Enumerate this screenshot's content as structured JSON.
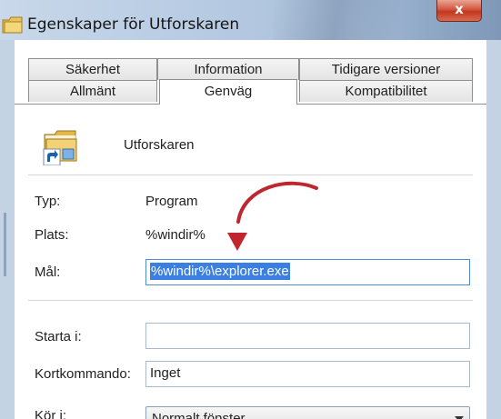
{
  "window": {
    "title": "Egenskaper för Utforskaren",
    "close_label": "x"
  },
  "tabs": {
    "row1": [
      "Säkerhet",
      "Information",
      "Tidigare versioner"
    ],
    "row2": [
      "Allmänt",
      "Genväg",
      "Kompatibilitet"
    ],
    "active": "Genväg"
  },
  "program": {
    "name": "Utforskaren",
    "icon": "folder-shortcut-icon"
  },
  "fields": {
    "type_label": "Typ:",
    "type_value": "Program",
    "location_label": "Plats:",
    "location_value": "%windir%",
    "target_label": "Mål:",
    "target_value": "%windir%\\explorer.exe",
    "start_in_label": "Starta i:",
    "start_in_value": "",
    "shortcut_key_label": "Kortkommando:",
    "shortcut_key_value": "Inget",
    "run_label": "Kör i:",
    "run_value": "Normalt fönster"
  },
  "annotation": {
    "arrow_color": "#c0262d"
  }
}
